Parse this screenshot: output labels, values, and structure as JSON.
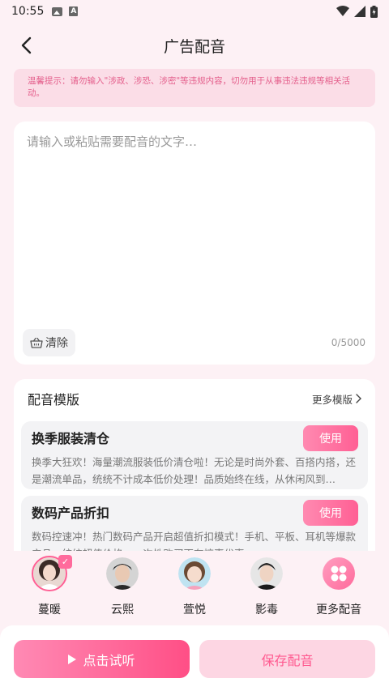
{
  "status_bar": {
    "time": "10:55"
  },
  "header": {
    "title": "广告配音"
  },
  "notice": {
    "text": "温馨提示：请勿输入\"涉政、涉恐、涉密\"等违规内容，切勿用于从事违法违规等相关活动。"
  },
  "editor": {
    "placeholder": "请输入或粘贴需要配音的文字…",
    "value": "",
    "clear_label": "清除",
    "counter": "0/5000"
  },
  "templates": {
    "title": "配音模版",
    "more_label": "更多模版",
    "items": [
      {
        "title": "换季服装清仓",
        "desc": "换季大狂欢！海量潮流服装低价清仓啦！无论是时尚外套、百搭内搭，还是潮流单品，统统不计成本低价处理！品质始终在线，从休闲风到…",
        "use_label": "使用"
      },
      {
        "title": "数码产品折扣",
        "desc": "数码控速冲！热门数码产品开启超值折扣模式！手机、平板、耳机等爆款产品，统统超值价格，一次性购买更有惊喜优惠…",
        "use_label": "使用"
      }
    ]
  },
  "voices": [
    {
      "name": "蔓暖",
      "selected": true
    },
    {
      "name": "云熙",
      "selected": false
    },
    {
      "name": "萱悦",
      "selected": false
    },
    {
      "name": "影毒",
      "selected": false
    },
    {
      "name": "更多配音",
      "selected": false
    }
  ],
  "bottom": {
    "listen_label": "点击试听",
    "save_label": "保存配音"
  },
  "colors": {
    "accent": "#ff5f94",
    "background": "#fdf1f5"
  }
}
